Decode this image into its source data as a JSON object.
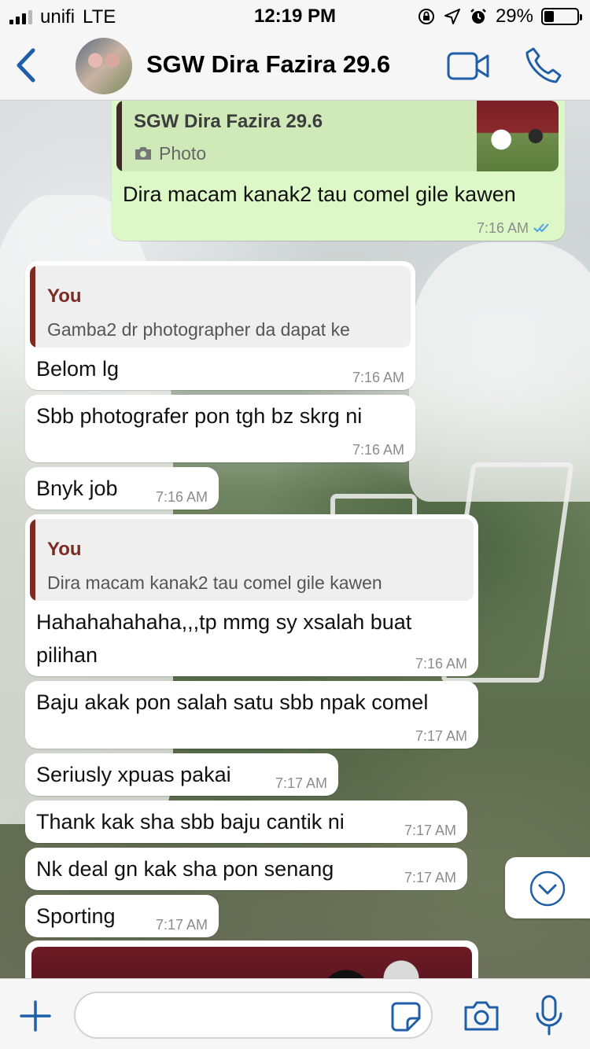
{
  "status_bar": {
    "carrier": "unifi",
    "network": "LTE",
    "time": "12:19 PM",
    "battery": "29%",
    "battery_level": 0.29
  },
  "header": {
    "contact_name": "SGW Dira Fazira 29.6"
  },
  "messages": [
    {
      "direction": "outgoing",
      "quote_author": "SGW Dira Fazira 29.6",
      "quote_type": "Photo",
      "text": "Dira macam kanak2 tau comel gile kawen",
      "time": "7:16 AM",
      "status": "read"
    },
    {
      "direction": "incoming",
      "quote_author": "You",
      "quote_text": "Gamba2 dr photographer da dapat ke",
      "text": "Belom lg",
      "time": "7:16 AM"
    },
    {
      "direction": "incoming",
      "text": "Sbb photografer pon tgh bz skrg ni",
      "time": "7:16 AM"
    },
    {
      "direction": "incoming",
      "text": "Bnyk job",
      "time": "7:16 AM"
    },
    {
      "direction": "incoming",
      "quote_author": "You",
      "quote_text": "Dira macam kanak2 tau comel gile kawen",
      "text_line1": "Hahahahahaha,,,tp mmg sy xsalah buat",
      "text_line2": "pilihan",
      "time": "7:16 AM"
    },
    {
      "direction": "incoming",
      "text": "Baju akak pon salah satu sbb npak comel",
      "time": "7:17 AM"
    },
    {
      "direction": "incoming",
      "text": "Seriusly xpuas pakai",
      "time": "7:17 AM"
    },
    {
      "direction": "incoming",
      "text": "Thank kak sha sbb baju cantik ni",
      "time": "7:17 AM"
    },
    {
      "direction": "incoming",
      "text": "Nk deal gn kak sha pon senang",
      "time": "7:17 AM"
    },
    {
      "direction": "incoming",
      "text": "Sporting",
      "time": "7:17 AM"
    }
  ],
  "input": {
    "value": "",
    "placeholder": ""
  },
  "colors": {
    "accent": "#1f5fa8",
    "outgoing_bubble": "#dcf8c6",
    "incoming_bubble": "#ffffff",
    "quote_bar": "#7b2b22",
    "read_ticks": "#4fa3e6"
  },
  "icons": [
    "signal-icon",
    "location-arrow-icon",
    "alarm-icon",
    "orientation-lock-icon",
    "battery-icon",
    "back-chevron-icon",
    "video-call-icon",
    "phone-icon",
    "camera-small-icon",
    "read-ticks-icon",
    "chevron-down-icon",
    "plus-icon",
    "sticker-icon",
    "camera-icon",
    "microphone-icon"
  ]
}
